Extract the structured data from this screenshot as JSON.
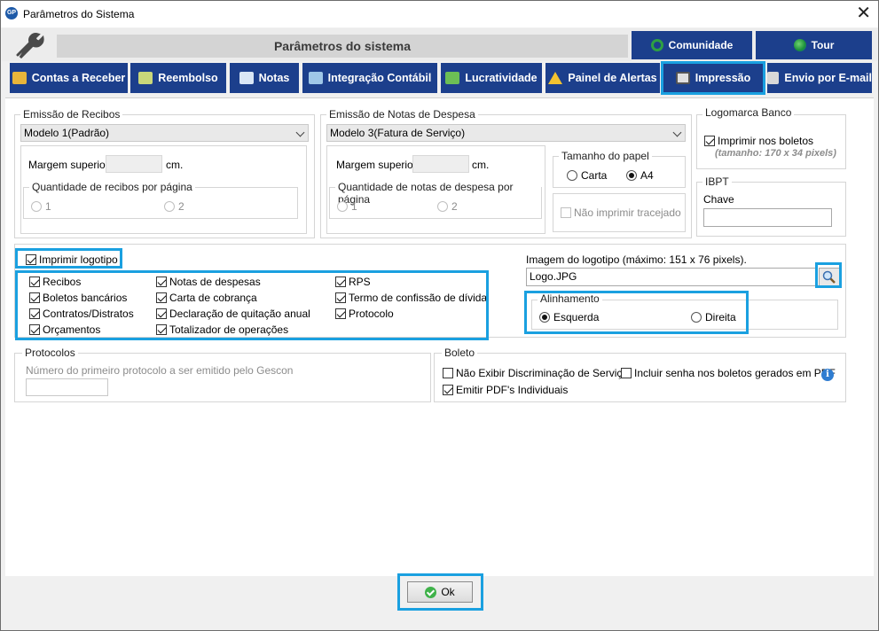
{
  "window": {
    "title": "Parâmetros do Sistema",
    "app_icon": "GP"
  },
  "header": {
    "title": "Parâmetros do sistema",
    "community": "Comunidade",
    "tour": "Tour"
  },
  "tabs": [
    {
      "label": "Contas a Receber"
    },
    {
      "label": "Reembolso"
    },
    {
      "label": "Notas"
    },
    {
      "label": "Integração Contábil"
    },
    {
      "label": "Lucratividade"
    },
    {
      "label": "Painel de Alertas"
    },
    {
      "label": "Impressão"
    },
    {
      "label": "Envio por E-mail"
    }
  ],
  "recibos": {
    "legend": "Emissão de Recibos",
    "model": "Modelo 1(Padrão)",
    "margin_label": "Margem superior",
    "unit": "cm.",
    "qty_legend": "Quantidade de recibos por página",
    "opt1": "1",
    "opt2": "2"
  },
  "notas_despesa": {
    "legend": "Emissão de Notas de Despesa",
    "model": "Modelo 3(Fatura de Serviço)",
    "margin_label": "Margem superior",
    "unit": "cm.",
    "qty_legend": "Quantidade de notas de despesa por página",
    "opt1": "1",
    "opt2": "2",
    "paper_legend": "Tamanho do papel",
    "paper_carta": "Carta",
    "paper_a4": "A4",
    "no_dash": "Não imprimir tracejado"
  },
  "logomarca": {
    "legend": "Logomarca Banco",
    "print_label": "Imprimir nos boletos",
    "size_hint": "(tamanho: 170 x 34 pixels)"
  },
  "ibpt": {
    "legend": "IBPT",
    "key_label": "Chave",
    "key_value": ""
  },
  "logotipo": {
    "print_label": "Imprimir logotipo",
    "items": [
      "Recibos",
      "Notas de despesas",
      "RPS",
      "Boletos bancários",
      "Carta de cobrança",
      "Termo de confissão de dívida",
      "Contratos/Distratos",
      "Declaração de quitação anual",
      "Protocolo",
      "Orçamentos",
      "Totalizador de operações"
    ],
    "image_label": "Imagem do logotipo (máximo: 151 x 76 pixels).",
    "image_value": "Logo.JPG",
    "align_legend": "Alinhamento",
    "align_left": "Esquerda",
    "align_right": "Direita"
  },
  "protocolos": {
    "legend": "Protocolos",
    "hint": "Número do primeiro protocolo a ser emitido pelo Gescon",
    "value": ""
  },
  "boleto": {
    "legend": "Boleto",
    "no_disc": "Não Exibir Discriminação de Serviço",
    "incl_pwd": "Incluir senha nos boletos gerados em PDF",
    "pdf_ind": "Emitir PDF's Individuais"
  },
  "footer": {
    "ok": "Ok"
  },
  "colors": {
    "nav_blue": "#1c3f8c",
    "highlight": "#1aa0e0"
  }
}
